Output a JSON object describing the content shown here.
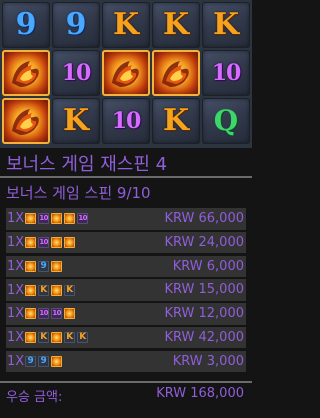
{
  "reels": {
    "rows": [
      [
        "9",
        "9",
        "K",
        "K",
        "K"
      ],
      [
        "fire",
        "10",
        "fire",
        "fire",
        "10"
      ],
      [
        "fire",
        "K",
        "10",
        "K",
        "Q"
      ]
    ]
  },
  "bonus": {
    "title": "보너스 게임 재스핀 4",
    "spin_label": "보너스 게임 스핀 9/10"
  },
  "wins": [
    {
      "multiplier": "1X",
      "symbols": [
        "fire",
        "10",
        "fire",
        "fire",
        "10"
      ],
      "amount": "KRW 66,000"
    },
    {
      "multiplier": "1X",
      "symbols": [
        "fire",
        "10",
        "fire",
        "fire"
      ],
      "amount": "KRW 24,000"
    },
    {
      "multiplier": "1X",
      "symbols": [
        "fire",
        "9",
        "fire"
      ],
      "amount": "KRW 6,000"
    },
    {
      "multiplier": "1X",
      "symbols": [
        "fire",
        "K",
        "fire",
        "K"
      ],
      "amount": "KRW 15,000"
    },
    {
      "multiplier": "1X",
      "symbols": [
        "fire",
        "10",
        "10",
        "fire"
      ],
      "amount": "KRW 12,000"
    },
    {
      "multiplier": "1X",
      "symbols": [
        "fire",
        "K",
        "fire",
        "K",
        "K"
      ],
      "amount": "KRW 42,000"
    },
    {
      "multiplier": "1X",
      "symbols": [
        "9",
        "9",
        "fire"
      ],
      "amount": "KRW 3,000"
    }
  ],
  "total": {
    "label": "우승 금액:",
    "amount": "KRW 168,000"
  },
  "colors": {
    "accent_text": "#8f5ed9",
    "background": "#141414",
    "row_background": "#333333",
    "divider": "#6a6a6a"
  }
}
